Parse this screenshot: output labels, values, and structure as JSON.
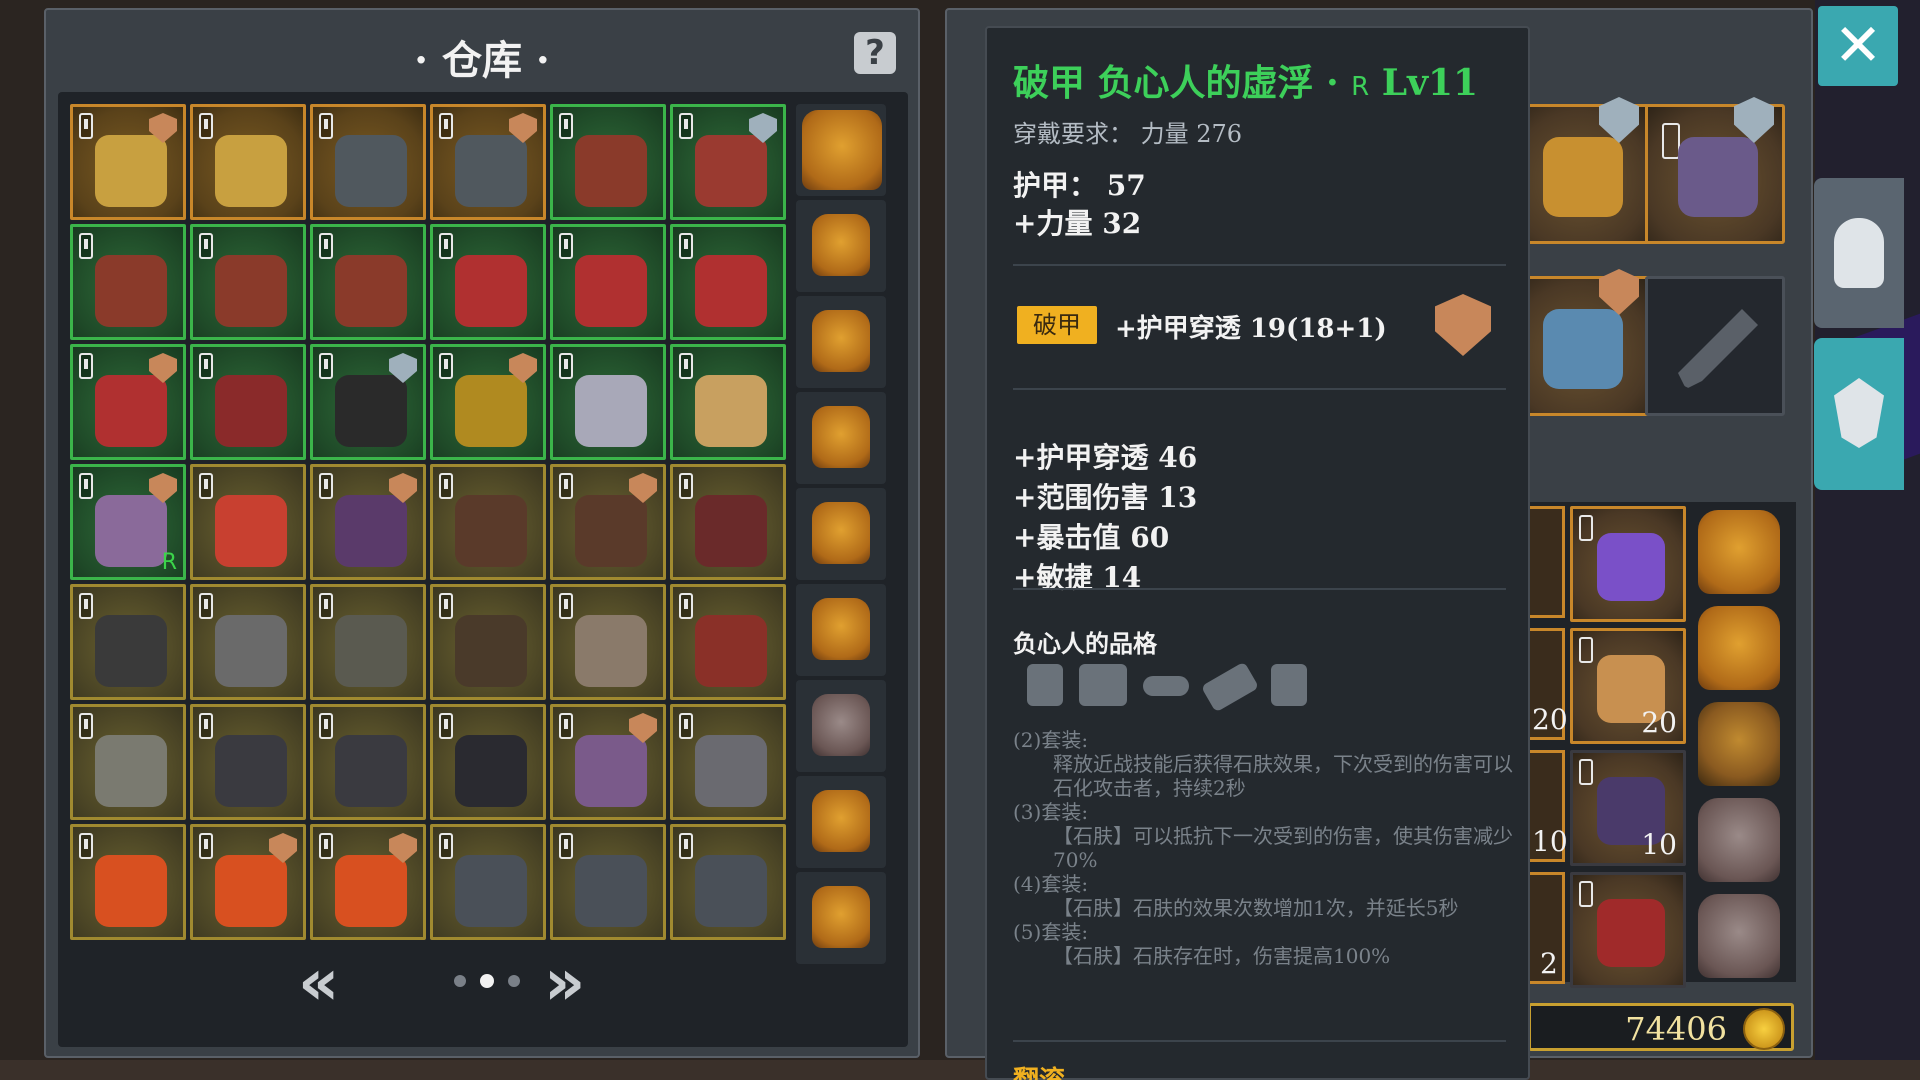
{
  "warehouse": {
    "title": "· 仓库 ·",
    "help_label": "?",
    "grid": [
      {
        "border": "orange",
        "shield": "bronze",
        "art": "#c8a040"
      },
      {
        "border": "orange",
        "shield": "",
        "art": "#c8a040"
      },
      {
        "border": "orange",
        "shield": "",
        "art": "#50585e"
      },
      {
        "border": "orange",
        "shield": "bronze",
        "art": "#50585e"
      },
      {
        "border": "green",
        "shield": "",
        "art": "#8a3a2a"
      },
      {
        "border": "green",
        "shield": "silver",
        "art": "#9a3a30"
      },
      {
        "border": "green",
        "shield": "",
        "art": "#8a3a2a"
      },
      {
        "border": "green",
        "shield": "",
        "art": "#8a3a2a"
      },
      {
        "border": "green",
        "shield": "",
        "art": "#8a3a2a"
      },
      {
        "border": "green",
        "shield": "",
        "art": "#b03030"
      },
      {
        "border": "green",
        "shield": "",
        "art": "#b03030"
      },
      {
        "border": "green",
        "shield": "",
        "art": "#b03030"
      },
      {
        "border": "green",
        "shield": "bronze",
        "art": "#b03030"
      },
      {
        "border": "green",
        "shield": "",
        "art": "#8a2a2a"
      },
      {
        "border": "green",
        "shield": "silver",
        "art": "#2a2a2a"
      },
      {
        "border": "green",
        "shield": "bronze",
        "art": "#b08a20"
      },
      {
        "border": "green",
        "shield": "",
        "art": "#a8a8b8"
      },
      {
        "border": "green",
        "shield": "",
        "art": "#c8a060"
      },
      {
        "border": "green",
        "shield": "bronze",
        "art": "#8a6a9a",
        "rank": "R"
      },
      {
        "border": "gold",
        "shield": "",
        "art": "#c84030"
      },
      {
        "border": "gold",
        "shield": "bronze",
        "art": "#5a3a6a"
      },
      {
        "border": "gold",
        "shield": "",
        "art": "#5a3a2a"
      },
      {
        "border": "gold",
        "shield": "bronze",
        "art": "#5a3a2a"
      },
      {
        "border": "gold",
        "shield": "",
        "art": "#6a2a2a"
      },
      {
        "border": "gold",
        "shield": "",
        "art": "#3a3a3a"
      },
      {
        "border": "gold",
        "shield": "",
        "art": "#6a6a6a"
      },
      {
        "border": "gold",
        "shield": "",
        "art": "#5a5a50"
      },
      {
        "border": "gold",
        "shield": "",
        "art": "#4a3a2a"
      },
      {
        "border": "gold",
        "shield": "",
        "art": "#8a7a6a"
      },
      {
        "border": "gold",
        "shield": "",
        "art": "#8a3028"
      },
      {
        "border": "gold",
        "shield": "",
        "art": "#7a7a70"
      },
      {
        "border": "gold",
        "shield": "",
        "art": "#3a3a40"
      },
      {
        "border": "gold",
        "shield": "",
        "art": "#3a3a40"
      },
      {
        "border": "gold",
        "shield": "",
        "art": "#2a2a30"
      },
      {
        "border": "gold",
        "shield": "bronze",
        "art": "#7a5a8a"
      },
      {
        "border": "gold",
        "shield": "",
        "art": "#6a6a70"
      },
      {
        "border": "gold",
        "shield": "",
        "art": "#d85020"
      },
      {
        "border": "gold",
        "shield": "bronze",
        "art": "#d85020"
      },
      {
        "border": "gold",
        "shield": "bronze",
        "art": "#d85020"
      },
      {
        "border": "gold",
        "shield": "",
        "art": "#4a5058"
      },
      {
        "border": "gold",
        "shield": "",
        "art": "#4a5058"
      },
      {
        "border": "gold",
        "shield": "",
        "art": "#4a5058"
      }
    ],
    "bags": [
      "big",
      "orange",
      "orange",
      "orange",
      "orange",
      "orange",
      "grey",
      "orange",
      "orange"
    ],
    "pager": {
      "prev": "«",
      "next": "»",
      "pages": 3,
      "current": 2
    }
  },
  "tooltip": {
    "title": "破甲 负心人的虚浮 · ",
    "rarity": "R",
    "level": " Lv11",
    "requirement": "穿戴要求：  力量 276",
    "armor": "护甲：  57",
    "strength": "+力量 32",
    "badge": "破甲",
    "penetration_bonus": "+护甲穿透 19(18+1)",
    "stats": [
      "+护甲穿透 46",
      "+范围伤害 13",
      "+暴击值 60",
      "+敏捷 14"
    ],
    "set_name": "负心人的品格",
    "set_bonuses": [
      {
        "head": "(2)套装:",
        "desc": "释放近战技能后获得石肤效果，下次受到的伤害可以石化攻击者，持续2秒"
      },
      {
        "head": "(3)套装:",
        "desc": "【石肤】可以抵抗下一次受到的伤害，使其伤害减少70%"
      },
      {
        "head": "(4)套装:",
        "desc": "【石肤】石肤的效果次数增加1次，并延长5秒"
      },
      {
        "head": "(5)套装:",
        "desc": "【石肤】石肤存在时，伤害提高100%"
      }
    ],
    "footer": "翻滚"
  },
  "inventory": {
    "quantities": [
      "20",
      "10"
    ],
    "partial_quantities": [
      "20",
      "10",
      "2"
    ],
    "gold": "74406"
  },
  "close_label": "✕",
  "colors": {
    "accent": "#3aa8b0",
    "green_text": "#3dd05a",
    "gold": "#f0b020"
  }
}
